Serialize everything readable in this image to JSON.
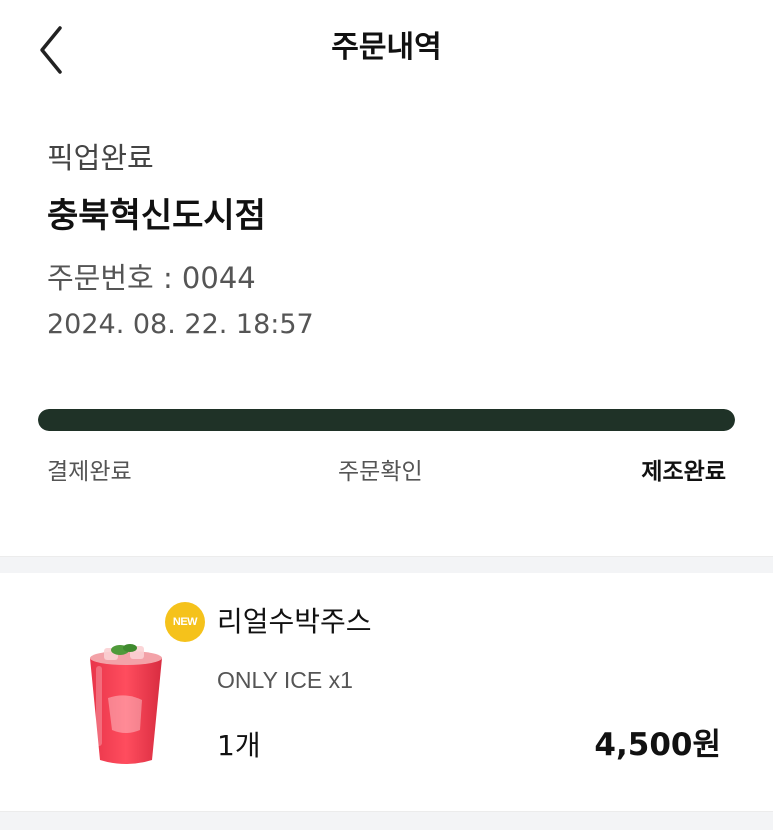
{
  "header": {
    "back_icon": "chevron-left-icon",
    "title": "주문내역"
  },
  "order": {
    "status": "픽업완료",
    "store": "충북혁신도시점",
    "order_number_text": "주문번호 : 0044",
    "datetime": "2024. 08. 22. 18:57"
  },
  "progress": {
    "fraction": 1.0,
    "fill_color": "#1f3227",
    "steps": [
      "결제완료",
      "주문확인",
      "제조완료"
    ],
    "active_step": 2
  },
  "item": {
    "badge": "NEW",
    "badge_color": "#f5c21b",
    "name": "리얼수박주스",
    "option": "ONLY ICE x1",
    "quantity": "1개",
    "price": "4,500원",
    "image_icon": "watermelon-juice-cup-image"
  }
}
